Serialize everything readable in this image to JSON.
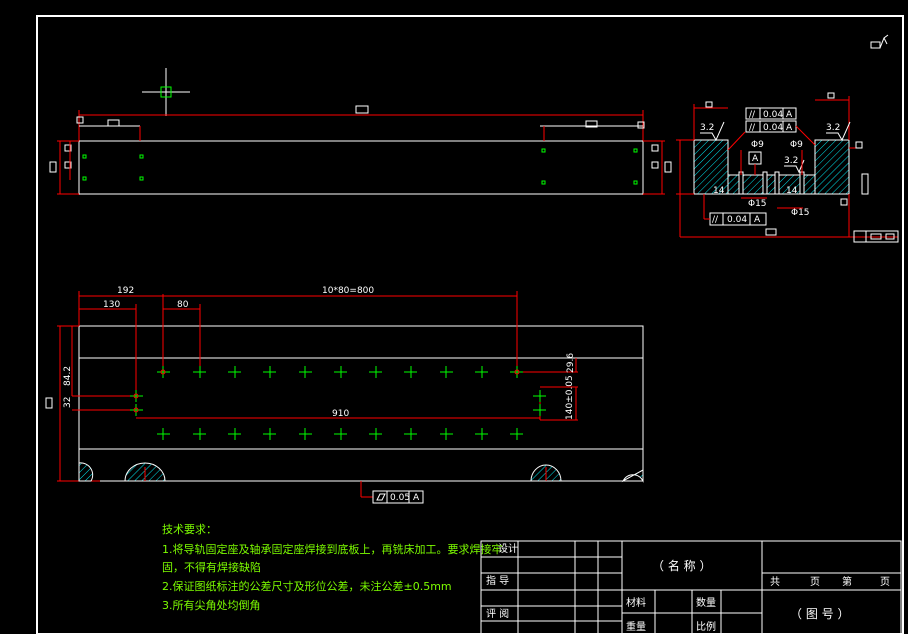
{
  "drawing": {
    "background": "#000000",
    "line_color": "#ffffff",
    "dim_color": "#ff0000",
    "note_color": "#7cfc00",
    "hatch_color": "#00ffff"
  },
  "top_view": {
    "roughness_side": "3.2",
    "tol1": "0.04",
    "tol2": "0.04",
    "datum": "A",
    "dia_left": "Φ9",
    "dia_right": "Φ9",
    "dia_15a": "Φ15",
    "dia_15b": "Φ15",
    "tol_bottom": "0.04",
    "dim_14a": "14",
    "dim_14b": "14",
    "rough_mid": "3.2",
    "rough_right": "3.2"
  },
  "plan_view": {
    "dim_192": "192",
    "dim_130": "130",
    "dim_80": "80",
    "dim_pitch": "10*80=800",
    "dim_910": "910",
    "dim_842": "84.2",
    "dim_32": "32",
    "dim_296": "29.6",
    "dim_140": "140±0.05",
    "flatness_value": "0.05",
    "flatness_datum": "A"
  },
  "notes": {
    "title": "技术要求：",
    "line1": "1.将导轨固定座及轴承固定座焊接到底板上，再铣床加工。要求焊接牢",
    "line2": "固，不得有焊接缺陷",
    "line3": "2.保证图纸标注的公差尺寸及形位公差，未注公差±0.5mm",
    "line4": "3.所有尖角处均倒角"
  },
  "title_block": {
    "design": "设计",
    "guide": "指 导",
    "review": "评 阅",
    "name": "（ 名    称 ）",
    "material": "材料",
    "quantity": "数量",
    "weight": "重量",
    "scale": "比例",
    "total": "共",
    "page1": "页",
    "sheet": "第",
    "page2": "页",
    "drawing_no": "（ 图    号 ）"
  }
}
